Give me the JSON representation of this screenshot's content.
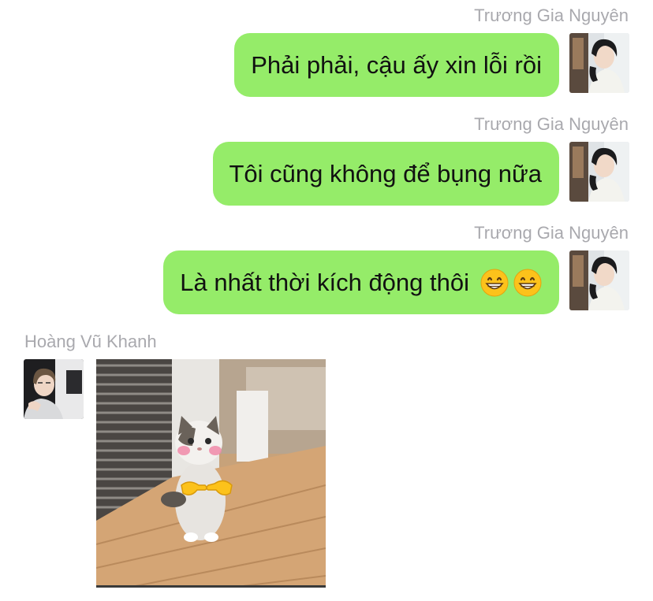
{
  "messages": [
    {
      "sender": "Trương Gia Nguyên",
      "side": "right",
      "text": "Phải phải, cậu ấy xin lỗi rồi"
    },
    {
      "sender": "Trương Gia Nguyên",
      "side": "right",
      "text": "Tôi cũng không để bụng nữa"
    },
    {
      "sender": "Trương Gia Nguyên",
      "side": "right",
      "text": "Là nhất thời kích động thôi",
      "emojis": [
        "grinning-face-icon",
        "grinning-face-icon"
      ]
    },
    {
      "sender": "Hoàng Vũ Khanh",
      "side": "left",
      "attachment": "cat-sticker-image"
    }
  ],
  "colors": {
    "outgoing_bubble": "#95ec69",
    "sender_name": "#a9a9ae",
    "message_text": "#111111",
    "background": "#ffffff"
  }
}
